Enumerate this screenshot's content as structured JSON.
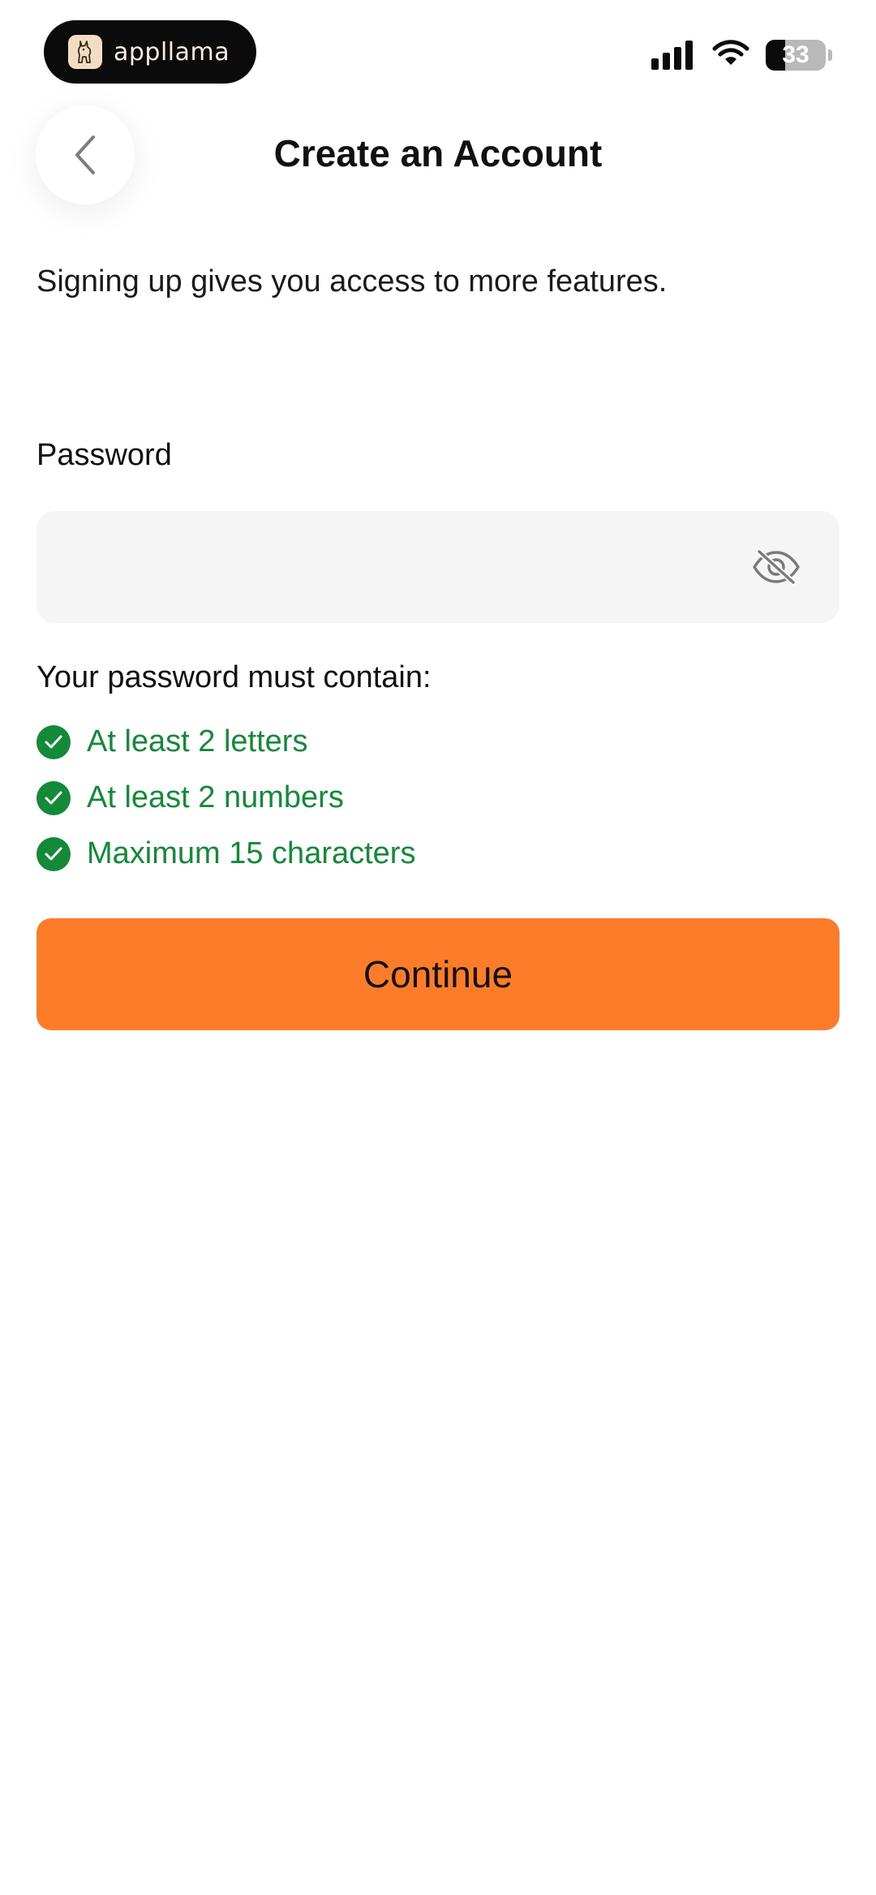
{
  "status_bar": {
    "app_name": "appllama",
    "battery_level": "33",
    "icons": [
      "llama-logo-icon",
      "cellular-signal-icon",
      "wifi-icon",
      "battery-icon"
    ]
  },
  "header": {
    "back_icon": "chevron-left-icon",
    "title": "Create an Account"
  },
  "intro": {
    "subtitle": "Signing up gives you access to more features."
  },
  "password": {
    "label": "Password",
    "value": "",
    "placeholder": "",
    "visibility_icon": "eye-slash-icon"
  },
  "requirements": {
    "heading": "Your password must contain:",
    "items": [
      {
        "label": "At least 2 letters",
        "met": true
      },
      {
        "label": "At least 2 numbers",
        "met": true
      },
      {
        "label": "Maximum 15 characters",
        "met": true
      }
    ]
  },
  "actions": {
    "continue_label": "Continue"
  },
  "colors": {
    "accent": "#fd7c29",
    "success": "#138a37",
    "field_bg": "#f5f5f5"
  }
}
